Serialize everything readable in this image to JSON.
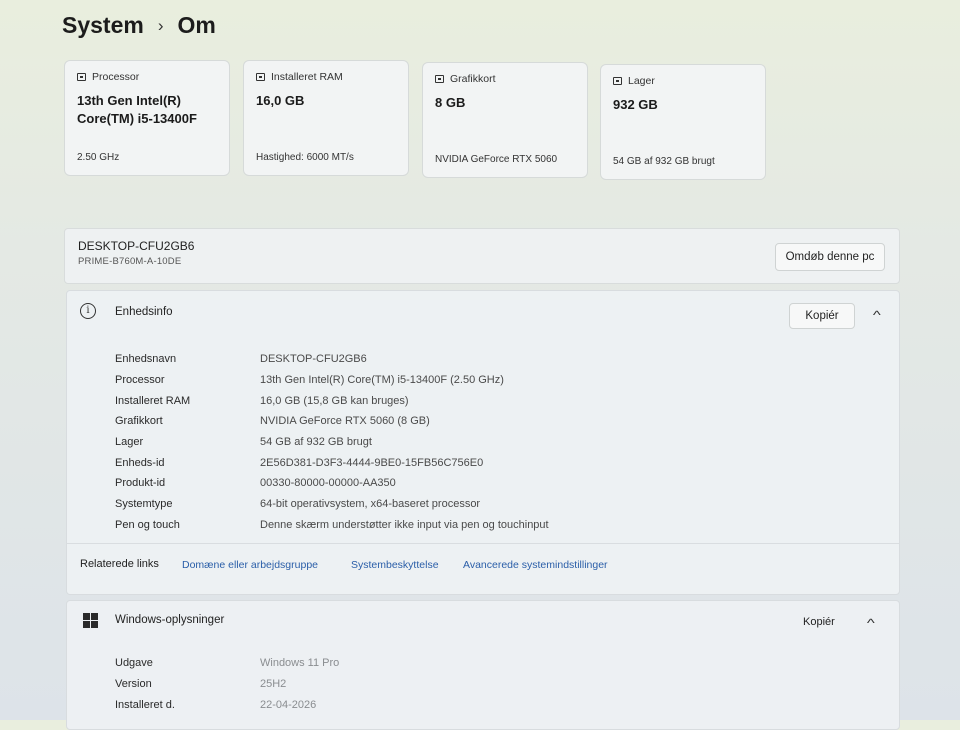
{
  "breadcrumb": {
    "parent": "System",
    "separator": "›",
    "current": "Om"
  },
  "cards": [
    {
      "label": "Processor",
      "value": "13th Gen Intel(R) Core(TM) i5-13400F",
      "sub": "2.50 GHz"
    },
    {
      "label": "Installeret RAM",
      "value": "16,0 GB",
      "sub": "Hastighed: 6000 MT/s"
    },
    {
      "label": "Grafikkort",
      "value": "8 GB",
      "sub": "NVIDIA GeForce RTX 5060"
    },
    {
      "label": "Lager",
      "value": "932 GB",
      "sub": "54 GB af 932 GB brugt"
    }
  ],
  "device": {
    "name": "DESKTOP-CFU2GB6",
    "model": "PRIME-B760M-A-10DE",
    "rename_label": "Omdøb denne pc"
  },
  "device_info": {
    "title": "Enhedsinfo",
    "copy_label": "Kopiér",
    "rows": [
      {
        "key": "Enhedsnavn",
        "value": "DESKTOP-CFU2GB6"
      },
      {
        "key": "Processor",
        "value": "13th Gen Intel(R) Core(TM) i5-13400F (2.50 GHz)"
      },
      {
        "key": "Installeret RAM",
        "value": "16,0 GB (15,8 GB kan bruges)"
      },
      {
        "key": "Grafikkort",
        "value": "NVIDIA GeForce RTX 5060 (8 GB)"
      },
      {
        "key": "Lager",
        "value": "54 GB af 932 GB brugt"
      },
      {
        "key": "Enheds-id",
        "value": "2E56D381-D3F3-4444-9BE0-15FB56C756E0"
      },
      {
        "key": "Produkt-id",
        "value": "00330-80000-00000-AA350"
      },
      {
        "key": "Systemtype",
        "value": "64-bit operativsystem, x64-baseret processor"
      },
      {
        "key": "Pen og touch",
        "value": "Denne skærm understøtter ikke input via pen og touchinput"
      }
    ]
  },
  "related": {
    "label": "Relaterede links",
    "links": [
      "Domæne eller arbejdsgruppe",
      "Systembeskyttelse",
      "Avancerede systemindstillinger"
    ]
  },
  "windows_info": {
    "title": "Windows-oplysninger",
    "copy_label": "Kopiér",
    "rows": [
      {
        "key": "Udgave",
        "value": "Windows 11 Pro"
      },
      {
        "key": "Version",
        "value": "25H2"
      },
      {
        "key": "Installeret d.",
        "value": "22-04-2026"
      }
    ]
  },
  "icons": {
    "card": "chip-icon",
    "info": "info-icon",
    "windows": "windows-logo-icon",
    "collapse": "chevron-up-icon"
  }
}
